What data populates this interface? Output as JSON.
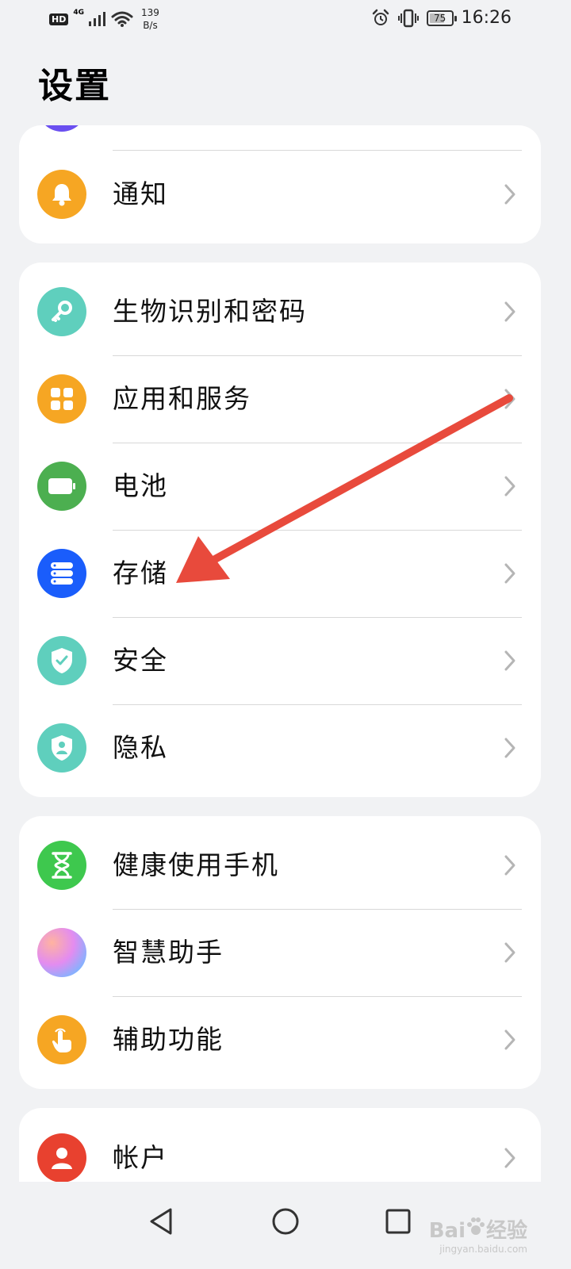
{
  "status_bar": {
    "hd": "HD",
    "network": "4G",
    "speed_value": "139",
    "speed_unit": "B/s",
    "battery": "75",
    "battery_level": 0.75,
    "time": "16:26"
  },
  "title": "设置",
  "sections": [
    {
      "items": [
        {
          "label": "通知",
          "icon": "bell-icon",
          "color": "#f6a623"
        }
      ]
    },
    {
      "items": [
        {
          "label": "生物识别和密码",
          "icon": "key-icon",
          "color": "#5fcfbd"
        },
        {
          "label": "应用和服务",
          "icon": "apps-grid-icon",
          "color": "#f6a623"
        },
        {
          "label": "电池",
          "icon": "battery-icon",
          "color": "#4caf50"
        },
        {
          "label": "存储",
          "icon": "storage-icon",
          "color": "#1a5dfb"
        },
        {
          "label": "安全",
          "icon": "shield-check-icon",
          "color": "#5fcfbd"
        },
        {
          "label": "隐私",
          "icon": "privacy-shield-icon",
          "color": "#5fcfbd"
        }
      ]
    },
    {
      "items": [
        {
          "label": "健康使用手机",
          "icon": "hourglass-icon",
          "color": "#3ec84e"
        },
        {
          "label": "智慧助手",
          "icon": "assistant-orb-icon",
          "color": "#c98ff0"
        },
        {
          "label": "辅助功能",
          "icon": "hand-touch-icon",
          "color": "#f6a623"
        }
      ]
    },
    {
      "items": [
        {
          "label": "帐户",
          "icon": "person-icon",
          "color": "#e8412f"
        }
      ]
    }
  ],
  "nav": [
    "back-icon",
    "home-icon",
    "recents-icon"
  ],
  "watermark": {
    "brand": "Bai",
    "brand2": "经验",
    "site": "jingyan.baidu.com"
  },
  "annotation": {
    "color": "#e84a3c"
  }
}
